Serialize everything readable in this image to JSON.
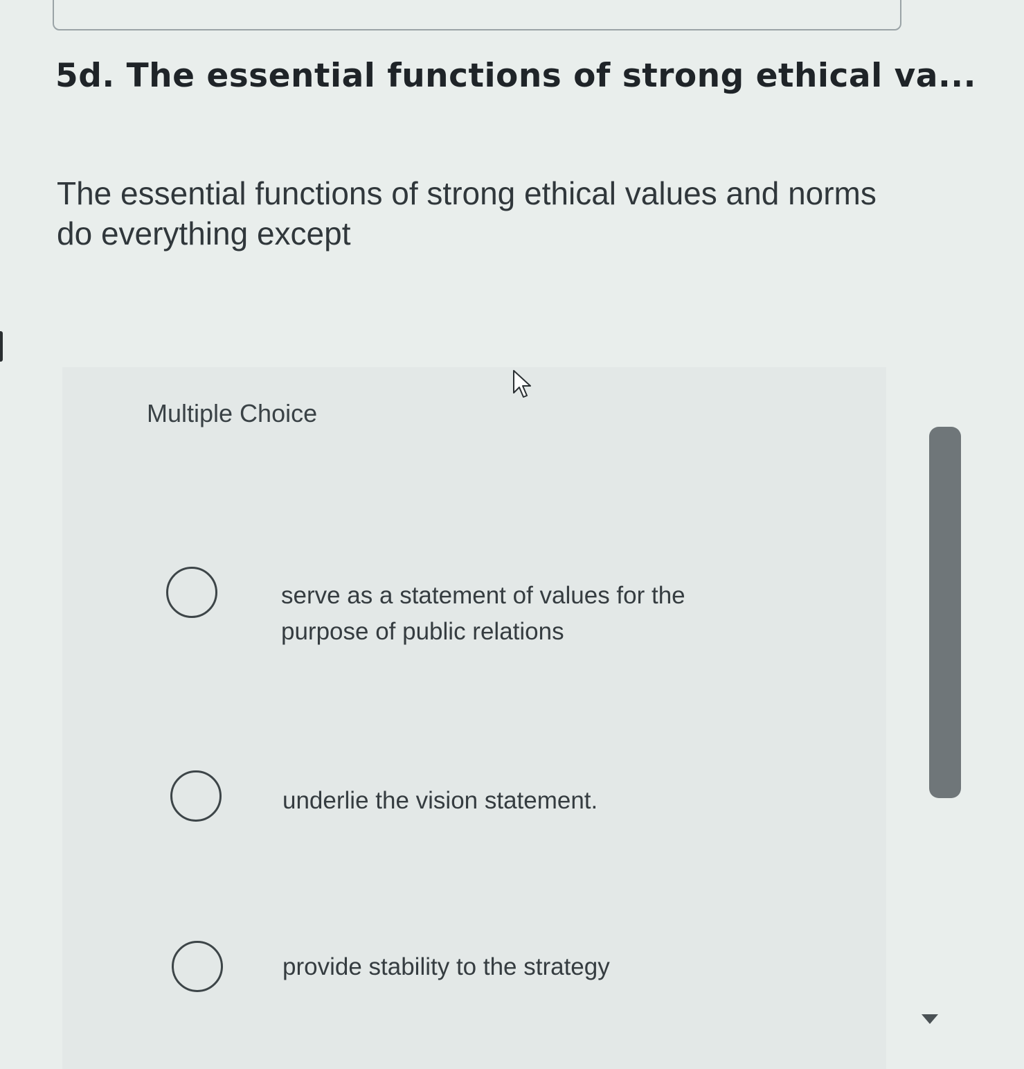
{
  "question": {
    "title": "5d. The essential functions of strong ethical va...",
    "prompt": "The essential functions of strong ethical values and norms do everything except"
  },
  "answer_section": {
    "heading": "Multiple Choice",
    "options": [
      {
        "label": "serve as a statement of values for the purpose of public relations",
        "selected": false
      },
      {
        "label": "underlie the vision statement.",
        "selected": false
      },
      {
        "label": "provide stability to the strategy",
        "selected": false
      }
    ]
  },
  "icons": {
    "cursor": "mouse-pointer-icon",
    "scroll_down": "triangle-down-icon"
  },
  "colors": {
    "background": "#e9eeec",
    "text": "#30373b",
    "radio_border": "#3d4548",
    "scrollbar_thumb": "#6f7679"
  }
}
